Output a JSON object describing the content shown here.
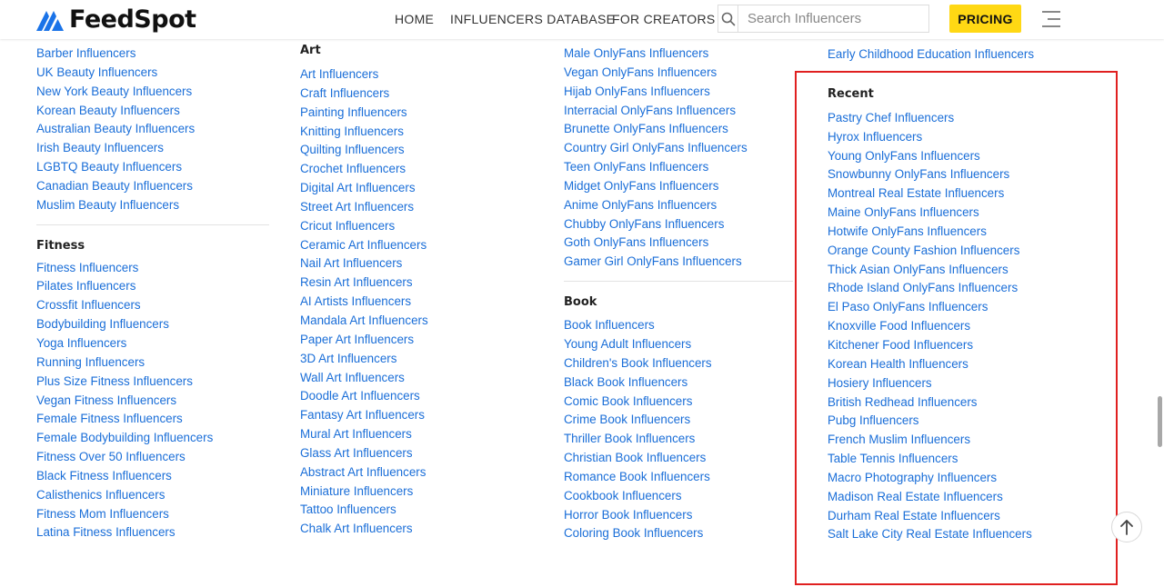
{
  "header": {
    "logo_text": "FeedSpot",
    "nav": {
      "home": "HOME",
      "database": "INFLUENCERS DATABASE",
      "creators": "FOR CREATORS"
    },
    "search_placeholder": "Search Influencers",
    "pricing": "PRICING",
    "icons": {
      "search": "search-icon",
      "menu": "hamburger-menu-icon"
    },
    "colors": {
      "pricing_bg": "#ffd814",
      "link": "#1a6ed8"
    }
  },
  "columns": {
    "col1": {
      "beauty_links": [
        "Barber Influencers",
        "UK Beauty Influencers",
        "New York Beauty Influencers",
        "Korean Beauty Influencers",
        "Australian Beauty Influencers",
        "Irish Beauty Influencers",
        "LGBTQ Beauty Influencers",
        "Canadian Beauty Influencers",
        "Muslim Beauty Influencers"
      ],
      "fitness_heading": "Fitness",
      "fitness_links": [
        "Fitness Influencers",
        "Pilates Influencers",
        "Crossfit Influencers",
        "Bodybuilding Influencers",
        "Yoga Influencers",
        "Running Influencers",
        "Plus Size Fitness Influencers",
        "Vegan Fitness Influencers",
        "Female Fitness Influencers",
        "Female Bodybuilding Influencers",
        "Fitness Over 50 Influencers",
        "Black Fitness Influencers",
        "Calisthenics Influencers",
        "Fitness Mom Influencers",
        "Latina Fitness Influencers"
      ]
    },
    "col2": {
      "art_heading": "Art",
      "art_links": [
        "Art Influencers",
        "Craft Influencers",
        "Painting Influencers",
        "Knitting Influencers",
        "Quilting Influencers",
        "Crochet Influencers",
        "Digital Art Influencers",
        "Street Art Influencers",
        "Cricut Influencers",
        "Ceramic Art Influencers",
        "Nail Art Influencers",
        "Resin Art Influencers",
        "AI Artists Influencers",
        "Mandala Art Influencers",
        "Paper Art Influencers",
        "3D Art Influencers",
        "Wall Art Influencers",
        "Doodle Art Influencers",
        "Fantasy Art Influencers",
        "Mural Art Influencers",
        "Glass Art Influencers",
        "Abstract Art Influencers",
        "Miniature Influencers",
        "Tattoo Influencers",
        "Chalk Art Influencers"
      ]
    },
    "col3": {
      "onlyfans_links": [
        "Male OnlyFans Influencers",
        "Vegan OnlyFans Influencers",
        "Hijab OnlyFans Influencers",
        "Interracial OnlyFans Influencers",
        "Brunette OnlyFans Influencers",
        "Country Girl OnlyFans Influencers",
        "Teen OnlyFans Influencers",
        "Midget OnlyFans Influencers",
        "Anime OnlyFans Influencers",
        "Chubby OnlyFans Influencers",
        "Goth OnlyFans Influencers",
        "Gamer Girl OnlyFans Influencers"
      ],
      "book_heading": "Book",
      "book_links": [
        "Book Influencers",
        "Young Adult Influencers",
        "Children's Book Influencers",
        "Black Book Influencers",
        "Comic Book Influencers",
        "Crime Book Influencers",
        "Thriller Book Influencers",
        "Christian Book Influencers",
        "Romance Book Influencers",
        "Cookbook Influencers",
        "Horror Book Influencers",
        "Coloring Book Influencers"
      ]
    },
    "col4": {
      "education_links": [
        "Early Childhood Education Influencers"
      ],
      "recent_heading": "Recent",
      "recent_links": [
        "Pastry Chef Influencers",
        "Hyrox Influencers",
        "Young OnlyFans Influencers",
        "Snowbunny OnlyFans Influencers",
        "Montreal Real Estate Influencers",
        "Maine OnlyFans Influencers",
        "Hotwife OnlyFans Influencers",
        "Orange County Fashion Influencers",
        "Thick Asian OnlyFans Influencers",
        "Rhode Island OnlyFans Influencers",
        "El Paso OnlyFans Influencers",
        "Knoxville Food Influencers",
        "Kitchener Food Influencers",
        "Korean Health Influencers",
        "Hosiery Influencers",
        "British Redhead Influencers",
        "Pubg Influencers",
        "French Muslim Influencers",
        "Table Tennis Influencers",
        "Macro Photography Influencers",
        "Madison Real Estate Influencers",
        "Durham Real Estate Influencers",
        "Salt Lake City Real Estate Influencers"
      ]
    }
  },
  "scroll_top_icon": "arrow-up-icon"
}
